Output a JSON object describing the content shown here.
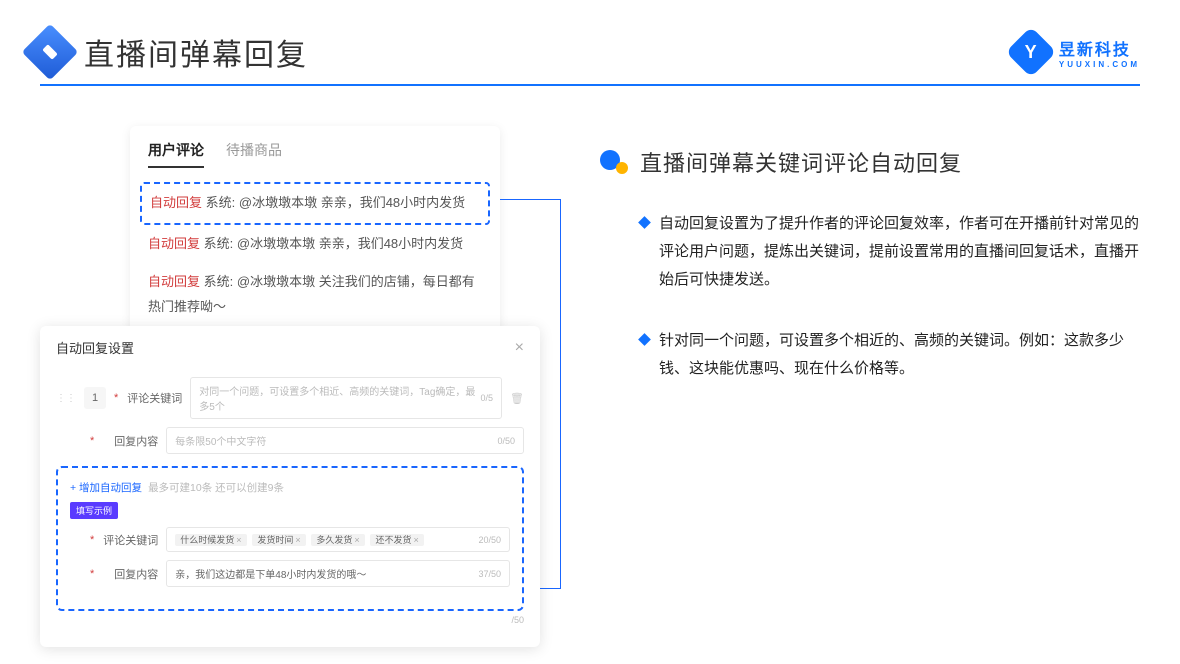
{
  "header": {
    "title": "直播间弹幕回复",
    "brand_cn": "昱新科技",
    "brand_en": "YUUXIN.COM",
    "brand_mark": "Y"
  },
  "commentCard": {
    "tabs": [
      "用户评论",
      "待播商品"
    ],
    "items": [
      {
        "auto": "自动回复",
        "sys": "系统:",
        "text": "@冰墩墩本墩 亲亲，我们48小时内发货"
      },
      {
        "auto": "自动回复",
        "sys": "系统:",
        "text": "@冰墩墩本墩 亲亲，我们48小时内发货"
      },
      {
        "auto": "自动回复",
        "sys": "系统:",
        "text": "@冰墩墩本墩 关注我们的店铺，每日都有热门推荐呦～"
      }
    ]
  },
  "settings": {
    "panel_title": "自动回复设置",
    "idx": "1",
    "label_keyword": "评论关键词",
    "placeholder_keyword": "对同一个问题，可设置多个相近、高频的关键词，Tag确定，最多5个",
    "count_keyword": "0/5",
    "label_content": "回复内容",
    "placeholder_content": "每条限50个中文字符",
    "count_content": "0/50",
    "add_label": "+ 增加自动回复",
    "add_hint": "最多可建10条 还可以创建9条",
    "badge": "填写示例",
    "ex_label_keyword": "评论关键词",
    "ex_tags": [
      "什么时候发货",
      "发货时间",
      "多久发货",
      "还不发货"
    ],
    "ex_count_keyword": "20/50",
    "ex_label_content": "回复内容",
    "ex_value_content": "亲，我们这边都是下单48小时内发货的哦～",
    "ex_count_content": "37/50",
    "bottom_count": "/50"
  },
  "right": {
    "section_title": "直播间弹幕关键词评论自动回复",
    "bullets": [
      "自动回复设置为了提升作者的评论回复效率，作者可在开播前针对常见的评论用户问题，提炼出关键词，提前设置常用的直播间回复话术，直播开始后可快捷发送。",
      "针对同一个问题，可设置多个相近的、高频的关键词。例如：这款多少钱、这块能优惠吗、现在什么价格等。"
    ]
  }
}
